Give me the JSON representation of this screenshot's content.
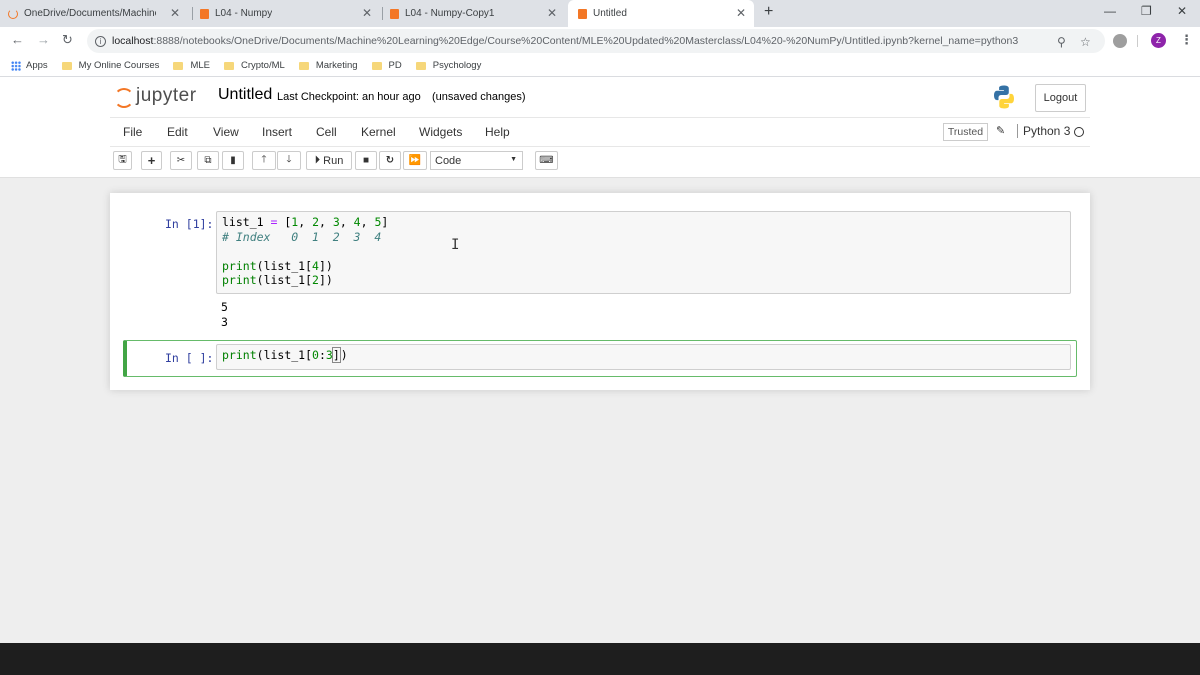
{
  "browser": {
    "tabs": [
      {
        "title": "OneDrive/Documents/Machine L",
        "icon": "jupyter-spinner-icon",
        "active": false
      },
      {
        "title": "L04 - Numpy",
        "icon": "notebook-icon",
        "active": false
      },
      {
        "title": "L04 - Numpy-Copy1",
        "icon": "notebook-icon",
        "active": false
      },
      {
        "title": "Untitled",
        "icon": "notebook-icon",
        "active": true
      }
    ],
    "new_tab": "+",
    "url_host": "localhost",
    "url_path": ":8888/notebooks/OneDrive/Documents/Machine%20Learning%20Edge/Course%20Content/MLE%20Updated%20Masterclass/L04%20-%20NumPy/Untitled.ipynb?kernel_name=python3",
    "profile_initial": "Z",
    "bookmarks": [
      {
        "label": "Apps",
        "type": "apps"
      },
      {
        "label": "My Online Courses",
        "type": "folder"
      },
      {
        "label": "MLE",
        "type": "folder"
      },
      {
        "label": "Crypto/ML",
        "type": "folder"
      },
      {
        "label": "Marketing",
        "type": "folder"
      },
      {
        "label": "PD",
        "type": "folder"
      },
      {
        "label": "Psychology",
        "type": "folder"
      }
    ]
  },
  "jupyter": {
    "logo_text": "jupyter",
    "notebook_name": "Untitled",
    "checkpoint": "Last Checkpoint: an hour ago",
    "autosave": "(unsaved changes)",
    "logout": "Logout",
    "menu": [
      "File",
      "Edit",
      "View",
      "Insert",
      "Cell",
      "Kernel",
      "Widgets",
      "Help"
    ],
    "trusted": "Trusted",
    "kernel": "Python 3",
    "toolbar": {
      "run": "Run",
      "cell_type": "Code"
    },
    "cells": [
      {
        "prompt": "In [1]:",
        "output": [
          "5",
          "3"
        ]
      },
      {
        "prompt": "In [ ]:"
      }
    ]
  },
  "colors": {
    "accent": "#f37726",
    "prompt": "#303f9f",
    "selected_cell": "#42a545"
  }
}
